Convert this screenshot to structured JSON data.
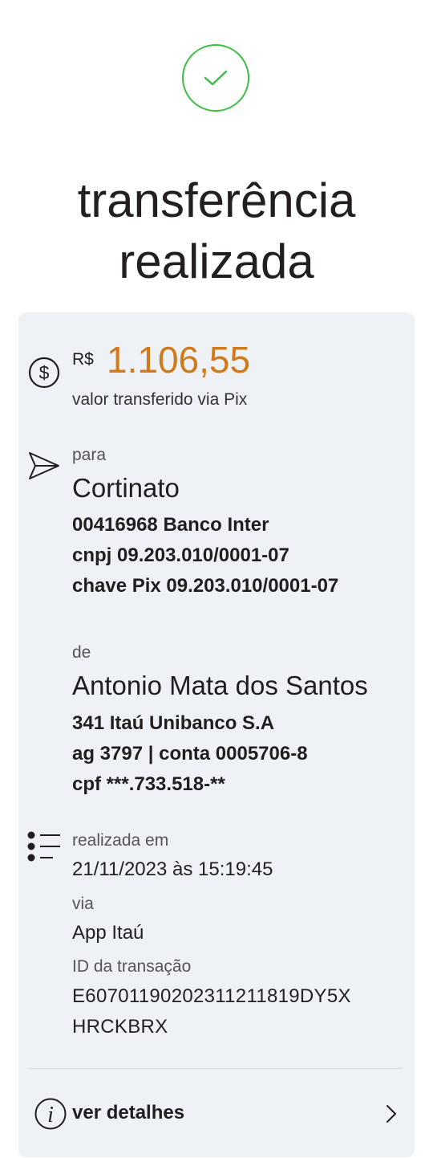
{
  "header": {
    "title_line1": "transferência",
    "title_line2": "realizada"
  },
  "amount": {
    "currency": "R$",
    "value": "1.106,55",
    "caption": "valor transferido via Pix"
  },
  "recipient": {
    "label": "para",
    "name": "Cortinato",
    "bank": "00416968 Banco Inter",
    "doc": "cnpj 09.203.010/0001-07",
    "pix_key": "chave Pix 09.203.010/0001-07"
  },
  "sender": {
    "label": "de",
    "name": "Antonio Mata dos Santos",
    "bank": "341 Itaú Unibanco S.A",
    "account": "ag 3797 | conta 0005706-8",
    "doc": "cpf ***.733.518-**"
  },
  "details": {
    "date_label": "realizada em",
    "date_value": "21/11/2023 às 15:19:45",
    "via_label": "via",
    "via_value": "App Itaú",
    "id_label": "ID da transação",
    "id_line1": "E60701190202311211819DY5X",
    "id_line2": "HRCKBRX"
  },
  "footer": {
    "details_link": "ver detalhes"
  },
  "colors": {
    "success": "#3fbd48",
    "amount": "#d07a1a",
    "card_bg": "#eef1f6"
  }
}
